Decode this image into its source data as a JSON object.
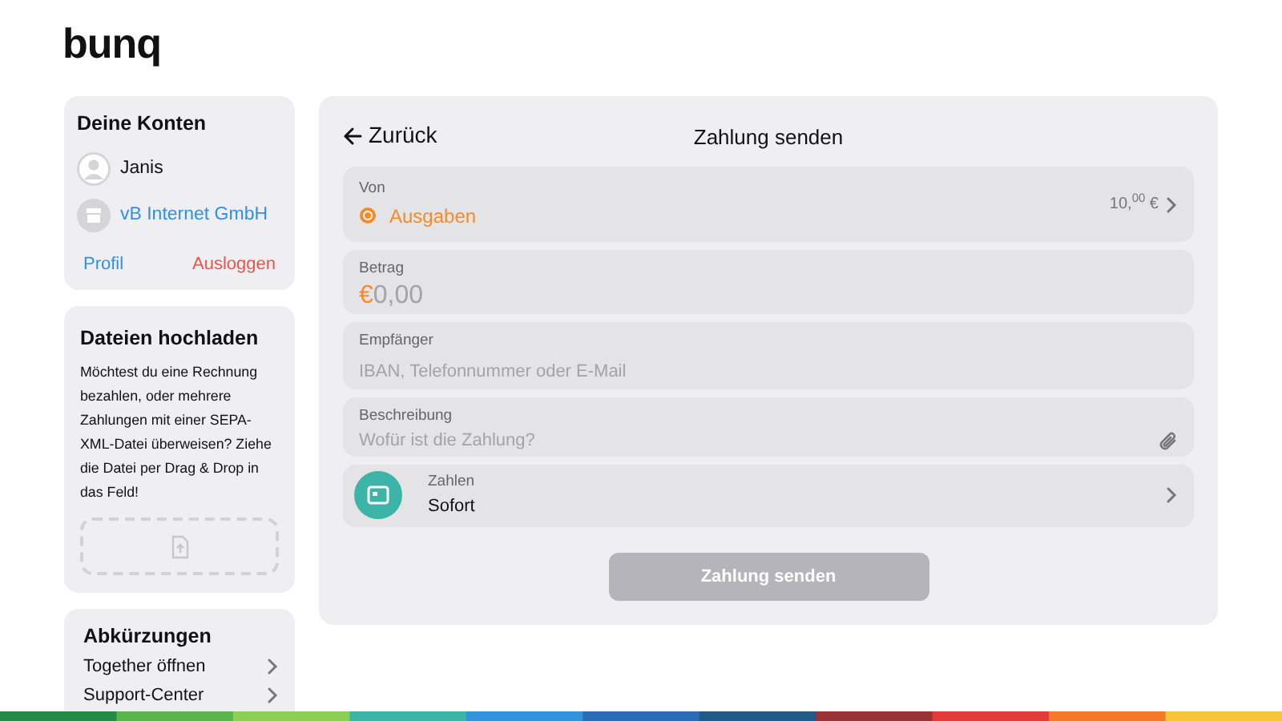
{
  "logo": "bunq",
  "accounts": {
    "title": "Deine Konten",
    "items": [
      {
        "kind": "person",
        "name": "Janis"
      },
      {
        "kind": "company",
        "name": "vB Internet GmbH"
      }
    ],
    "profile_link": "Profil",
    "logout_link": "Ausloggen"
  },
  "upload": {
    "title": "Dateien hochladen",
    "text": "Möchtest du eine Rechnung bezahlen, oder mehrere Zahlungen mit einer SEPA-XML-Datei überweisen? Ziehe die Datei per Drag & Drop in das Feld!"
  },
  "shortcuts": {
    "title": "Abkürzungen",
    "items": [
      "Together öffnen",
      "Support-Center"
    ]
  },
  "form": {
    "back": "Zurück",
    "title": "Zahlung senden",
    "from": {
      "label": "Von",
      "account": "Ausgaben",
      "balance": "10,$^{00}$ €"
    },
    "amount": {
      "label": "Betrag",
      "currency": "€",
      "value": "0,00"
    },
    "recipient": {
      "label": "Empfänger",
      "placeholder": "IBAN, Telefonnummer oder E-Mail"
    },
    "description": {
      "label": "Beschreibung",
      "placeholder": "Wofür ist die Zahlung?"
    },
    "schedule": {
      "label": "Zahlen",
      "value": "Sofort"
    },
    "submit": {
      "label": "Zahlung senden",
      "disabled": true
    }
  }
}
